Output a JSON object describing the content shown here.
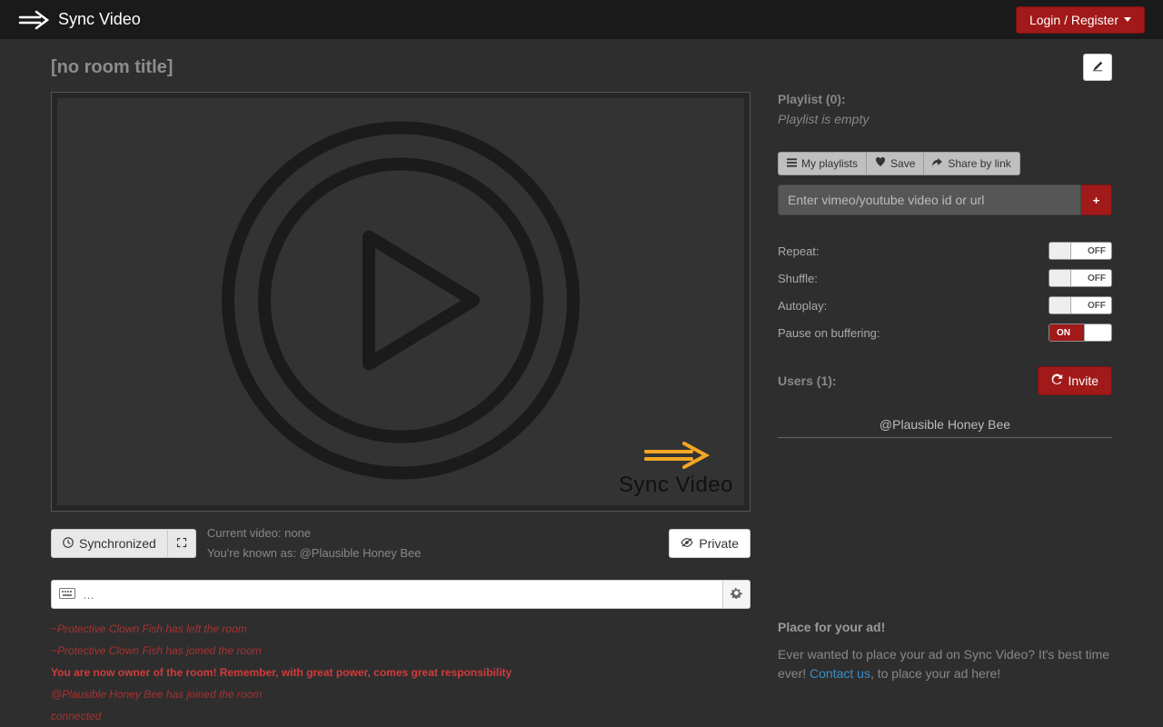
{
  "brand": {
    "name": "Sync Video"
  },
  "header": {
    "login_label": "Login / Register"
  },
  "room": {
    "title": "[no room title]"
  },
  "player": {
    "brand_text": "Sync Video"
  },
  "status": {
    "sync_label": "Synchronized",
    "current_video_label": "Current video:",
    "current_video_value": "none",
    "known_as_label": "You're known as:",
    "known_as_value": "@Plausible Honey Bee",
    "private_label": "Private"
  },
  "chat": {
    "placeholder": "…",
    "log": [
      {
        "type": "sys",
        "text": "~Protective Clown Fish has left the room"
      },
      {
        "type": "sys",
        "text": "~Protective Clown Fish has joined the room"
      },
      {
        "type": "sysbold",
        "text": "You are now owner of the room! Remember, with great power, comes great responsibility"
      },
      {
        "type": "sys",
        "text": "@Plausible Honey Bee has joined the room"
      },
      {
        "type": "sys",
        "text": "connected"
      }
    ]
  },
  "playlist": {
    "header": "Playlist (0):",
    "empty_text": "Playlist is empty",
    "buttons": {
      "my_playlists": "My playlists",
      "save": "Save",
      "share": "Share by link"
    },
    "url_placeholder": "Enter vimeo/youtube video id or url"
  },
  "toggles": {
    "repeat": {
      "label": "Repeat:",
      "state": "OFF"
    },
    "shuffle": {
      "label": "Shuffle:",
      "state": "OFF"
    },
    "autoplay": {
      "label": "Autoplay:",
      "state": "OFF"
    },
    "pause": {
      "label": "Pause on buffering:",
      "state": "ON"
    }
  },
  "users": {
    "header": "Users (1):",
    "invite_label": "Invite",
    "list": [
      "@Plausible Honey Bee"
    ]
  },
  "ad": {
    "header": "Place for your ad!",
    "text_before": "Ever wanted to place your ad on Sync Video? It's best time ever! ",
    "link": "Contact us",
    "text_after": ", to place your ad here!"
  }
}
